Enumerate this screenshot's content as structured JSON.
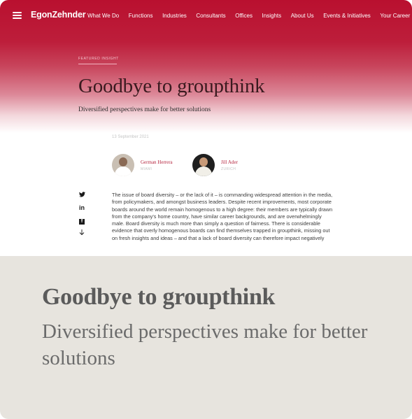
{
  "nav": {
    "logo": "EgonZehnder",
    "items": [
      "What We Do",
      "Functions",
      "Industries",
      "Consultants",
      "Offices",
      "Insights",
      "About Us",
      "Events & Initiatives",
      "Your Career"
    ]
  },
  "article": {
    "eyebrow": "FEATURED INSIGHT",
    "title": "Goodbye to groupthink",
    "subtitle": "Diversified perspectives make for better solutions",
    "date": "13 September 2021",
    "authors": [
      {
        "name": "German Herrera",
        "location": "MIAMI"
      },
      {
        "name": "Jill Ader",
        "location": "ZURICH"
      }
    ],
    "share_icons": [
      "twitter-icon",
      "linkedin-icon",
      "facebook-icon",
      "download-icon"
    ],
    "body": "The issue of board diversity – or the lack of it – is commanding widespread attention in the media, from policymakers, and amongst business leaders. Despite recent improvements, most corporate boards around the world remain homogenous to a high degree: their members are typically drawn from the company's home country, have similar career backgrounds, and are overwhelmingly male. Board diversity is much more than simply a question of fairness. There is considerable evidence that overly homogenous boards can find themselves trapped in groupthink, missing out on fresh insights and ideas – and that a lack of board diversity can therefore impact negatively"
  },
  "caption": {
    "title": "Goodbye to groupthink",
    "subtitle": "Diversified perspectives make for better solutions"
  },
  "colors": {
    "brand": "#b9102f",
    "caption_bg": "#e7e4de",
    "author_name": "#b5243e"
  }
}
